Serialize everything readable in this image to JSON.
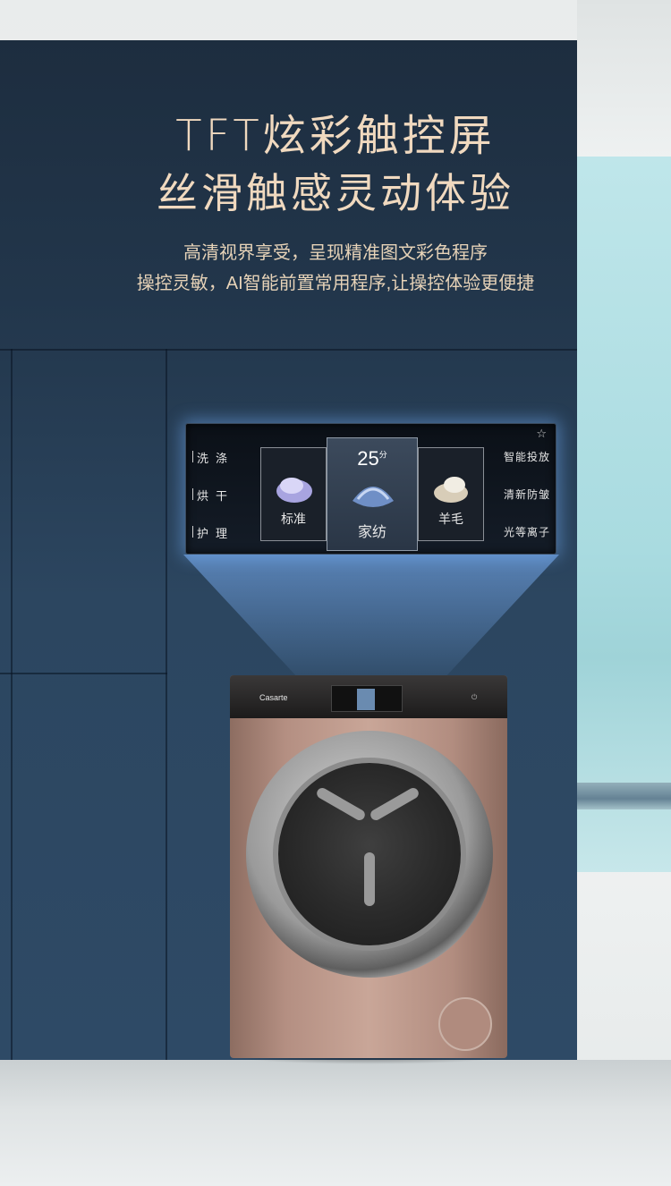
{
  "headline": {
    "line1": "TFT炫彩触控屏",
    "line2": "丝滑触感灵动体验"
  },
  "subtitle": {
    "line1": "高清视界享受，呈现精准图文彩色程序",
    "line2": "操控灵敏，AI智能前置常用程序,让操控体验更便捷"
  },
  "panel": {
    "tabs": [
      "洗涤",
      "烘干",
      "护理"
    ],
    "programs": [
      {
        "label": "标准"
      },
      {
        "label": "家纺",
        "selected": true
      },
      {
        "label": "羊毛"
      }
    ],
    "temperature": "25",
    "temperature_unit": "分",
    "functions": [
      "智能投放",
      "清新防皱",
      "光等离子"
    ],
    "favorite_icon": "star-icon"
  },
  "washer": {
    "brand": "Casarte"
  },
  "colors": {
    "wall": "#2c4660",
    "gold_text": "#f0d9bf",
    "washer_body": "#c9a698"
  }
}
